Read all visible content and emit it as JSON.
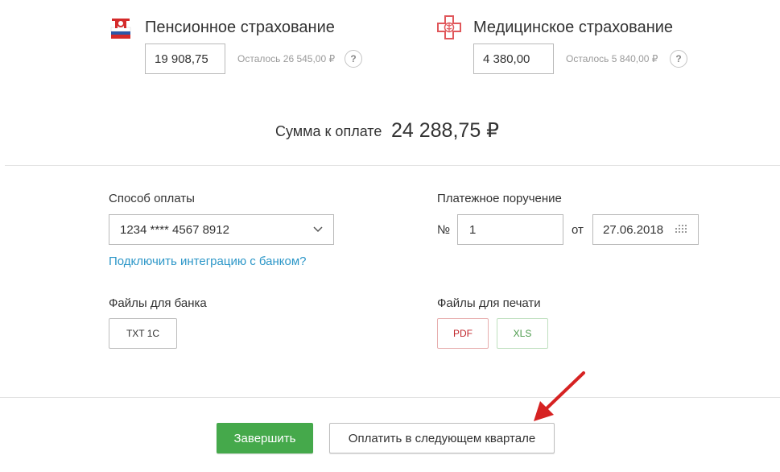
{
  "pension": {
    "title": "Пенсионное страхование",
    "amount": "19 908,75",
    "remaining": "Осталось 26 545,00 ₽",
    "help": "?",
    "logo_text": "ПФР"
  },
  "medical": {
    "title": "Медицинское страхование",
    "amount": "4 380,00",
    "remaining": "Осталось 5 840,00 ₽",
    "help": "?"
  },
  "total": {
    "label": "Сумма к оплате",
    "value": "24 288,75 ₽"
  },
  "payment_method": {
    "label": "Способ оплаты",
    "selected": "1234 **** 4567 8912",
    "integration_link": "Подключить интеграцию с банком?"
  },
  "payment_order": {
    "label": "Платежное поручение",
    "number_sign": "№",
    "number": "1",
    "from_label": "от",
    "date": "27.06.2018"
  },
  "bank_files": {
    "label": "Файлы для банка",
    "txt_button": "TXT 1C"
  },
  "print_files": {
    "label": "Файлы для печати",
    "pdf_button": "PDF",
    "xls_button": "XLS"
  },
  "footer": {
    "finish_button": "Завершить",
    "next_quarter_button": "Оплатить в следующем квартале"
  },
  "colors": {
    "primary_green": "#45a94b",
    "link_blue": "#2d97c8",
    "pdf_red": "#c1272d",
    "xls_green": "#4a9a4a",
    "arrow_red": "#d62222"
  },
  "icons": {
    "pension_logo": "pfr-logo-icon",
    "medical_logo": "medical-cross-icon",
    "dropdown": "chevron-down-icon",
    "calendar": "calendar-grid-icon",
    "arrow": "red-arrow-icon"
  }
}
